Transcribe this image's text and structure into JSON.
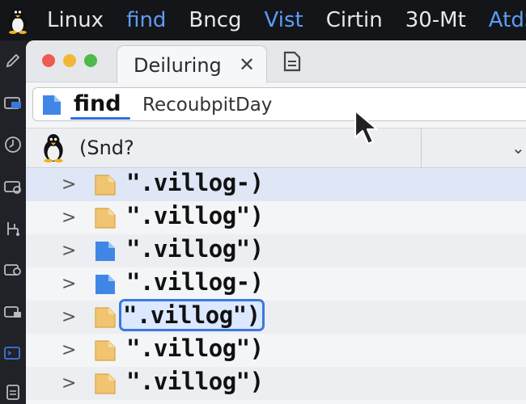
{
  "menubar": {
    "items": [
      {
        "label": "Linux",
        "color": "#e8e8e8"
      },
      {
        "label": "find",
        "color": "#5d9cf5"
      },
      {
        "label": "Bncg",
        "color": "#e8e8e8"
      },
      {
        "label": "Vist",
        "color": "#5d9cf5"
      },
      {
        "label": "Cirtin",
        "color": "#e8e8e8"
      },
      {
        "label": "30-Mt",
        "color": "#e8e8e8"
      },
      {
        "label": "AtdS",
        "color": "#5d9cf5"
      }
    ]
  },
  "dock": {
    "icons": [
      "pencil-icon",
      "folder-icon",
      "disk-icon",
      "drive-icon",
      "network-icon",
      "package-icon",
      "lock-icon",
      "terminal-icon",
      "document-icon"
    ]
  },
  "window": {
    "tab": {
      "label": "Deiluring",
      "close": "✕"
    },
    "find": {
      "term": "find",
      "text": "RecoubpitDay"
    },
    "path": {
      "label": "(Snd?",
      "dropdown": "⌄"
    },
    "files": [
      {
        "name": "\".villog-)",
        "icon": "folder-yellow-icon",
        "highlight": "#dfe6f5",
        "editing": false
      },
      {
        "name": "\".villog\")",
        "icon": "folder-yellow-icon",
        "highlight": "#f4f5f7",
        "editing": false
      },
      {
        "name": "\".villog\")",
        "icon": "file-blue-icon",
        "highlight": "#eceef1",
        "editing": false
      },
      {
        "name": "\".villog-)",
        "icon": "file-blue-icon",
        "highlight": "#f4f5f7",
        "editing": false
      },
      {
        "name": "\".villog\")",
        "icon": "folder-yellow-icon",
        "highlight": "#eceef1",
        "editing": true
      },
      {
        "name": "\".villog\")",
        "icon": "folder-yellow-icon",
        "highlight": "#f4f5f7",
        "editing": false
      },
      {
        "name": "\".villog\")",
        "icon": "folder-yellow-icon",
        "highlight": "#eceef1",
        "editing": false
      }
    ]
  },
  "colors": {
    "accent": "#3a78e0",
    "folder": "#f0c470",
    "file_blue": "#3f86e6"
  }
}
